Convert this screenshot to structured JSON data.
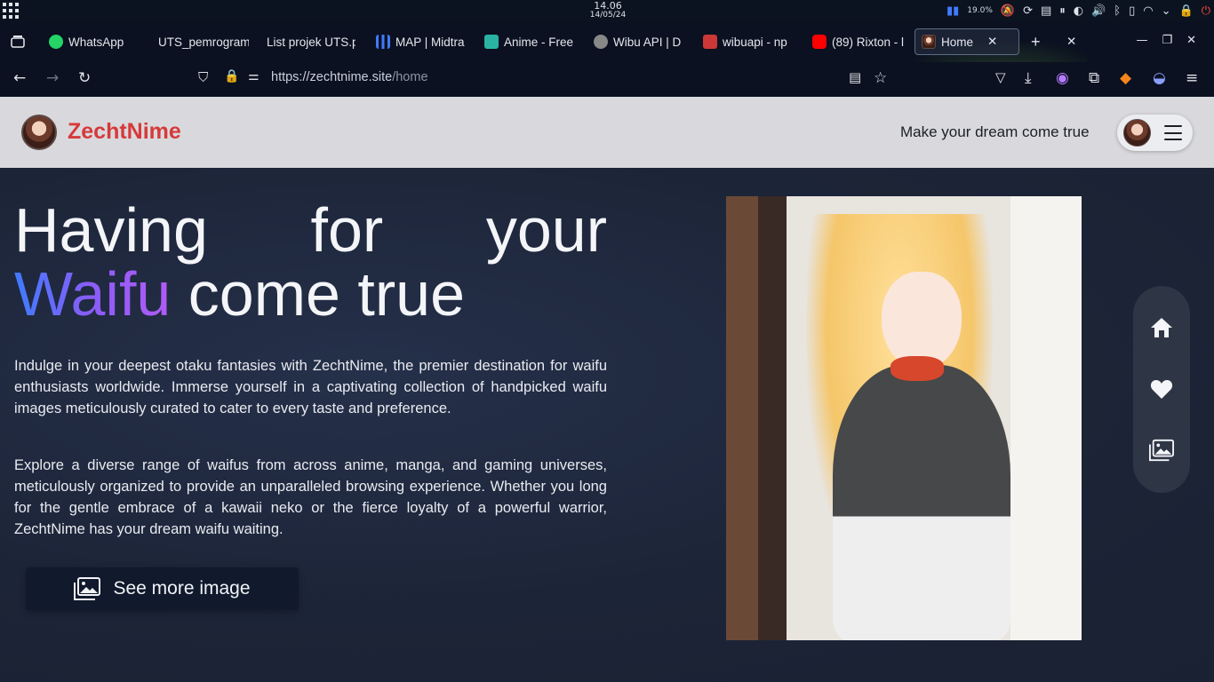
{
  "system": {
    "time": "14.06",
    "date": "14/05/24",
    "battery": "19.0%"
  },
  "tabs": [
    {
      "label": "WhatsApp",
      "icon": "whatsapp-icon",
      "color": "#25d366"
    },
    {
      "label": "UTS_pemrogram",
      "icon": "blank-icon",
      "color": "#0b1120"
    },
    {
      "label": "List projek UTS.p",
      "icon": "blank-icon",
      "color": "#0b1120"
    },
    {
      "label": "MAP | Midtra",
      "icon": "bars-icon",
      "color": "#3f7bff"
    },
    {
      "label": "Anime - Free",
      "icon": "a-icon",
      "color": "#2ab3a3"
    },
    {
      "label": "Wibu API | D",
      "icon": "avatar-icon",
      "color": "#888888"
    },
    {
      "label": "wibuapi - np",
      "icon": "npm-icon",
      "color": "#cb3837"
    },
    {
      "label": "(89) Rixton - l",
      "icon": "youtube-icon",
      "color": "#ff0000"
    },
    {
      "label": "Home",
      "icon": "avatar-icon",
      "color": "#6b3a2a"
    }
  ],
  "address_bar": {
    "host": "https://zechtnime.site",
    "path": "/home"
  },
  "site": {
    "brand": "ZechtNime",
    "tagline": "Make your dream come true",
    "brand_color": "#d63a3a"
  },
  "hero": {
    "heading_line1_words": [
      "Having",
      "for",
      "your"
    ],
    "heading_highlight": "Waifu",
    "heading_rest": " come true",
    "paragraph1": "Indulge in your deepest otaku fantasies with ZechtNime, the premier destination for waifu enthusiasts worldwide. Immerse yourself in a captivating collection of handpicked waifu images meticulously curated to cater to every taste and preference.",
    "paragraph2": "Explore a diverse range of waifus from across anime, manga, and gaming universes, meticulously organized to provide an unparalleled browsing experience. Whether you long for the gentle embrace of a kawaii neko or the fierce loyalty of a powerful warrior, ZechtNime has your dream waifu waiting.",
    "cta_label": "See more image"
  },
  "side_nav": [
    {
      "icon": "home-icon"
    },
    {
      "icon": "heart-icon"
    },
    {
      "icon": "gallery-icon"
    }
  ]
}
